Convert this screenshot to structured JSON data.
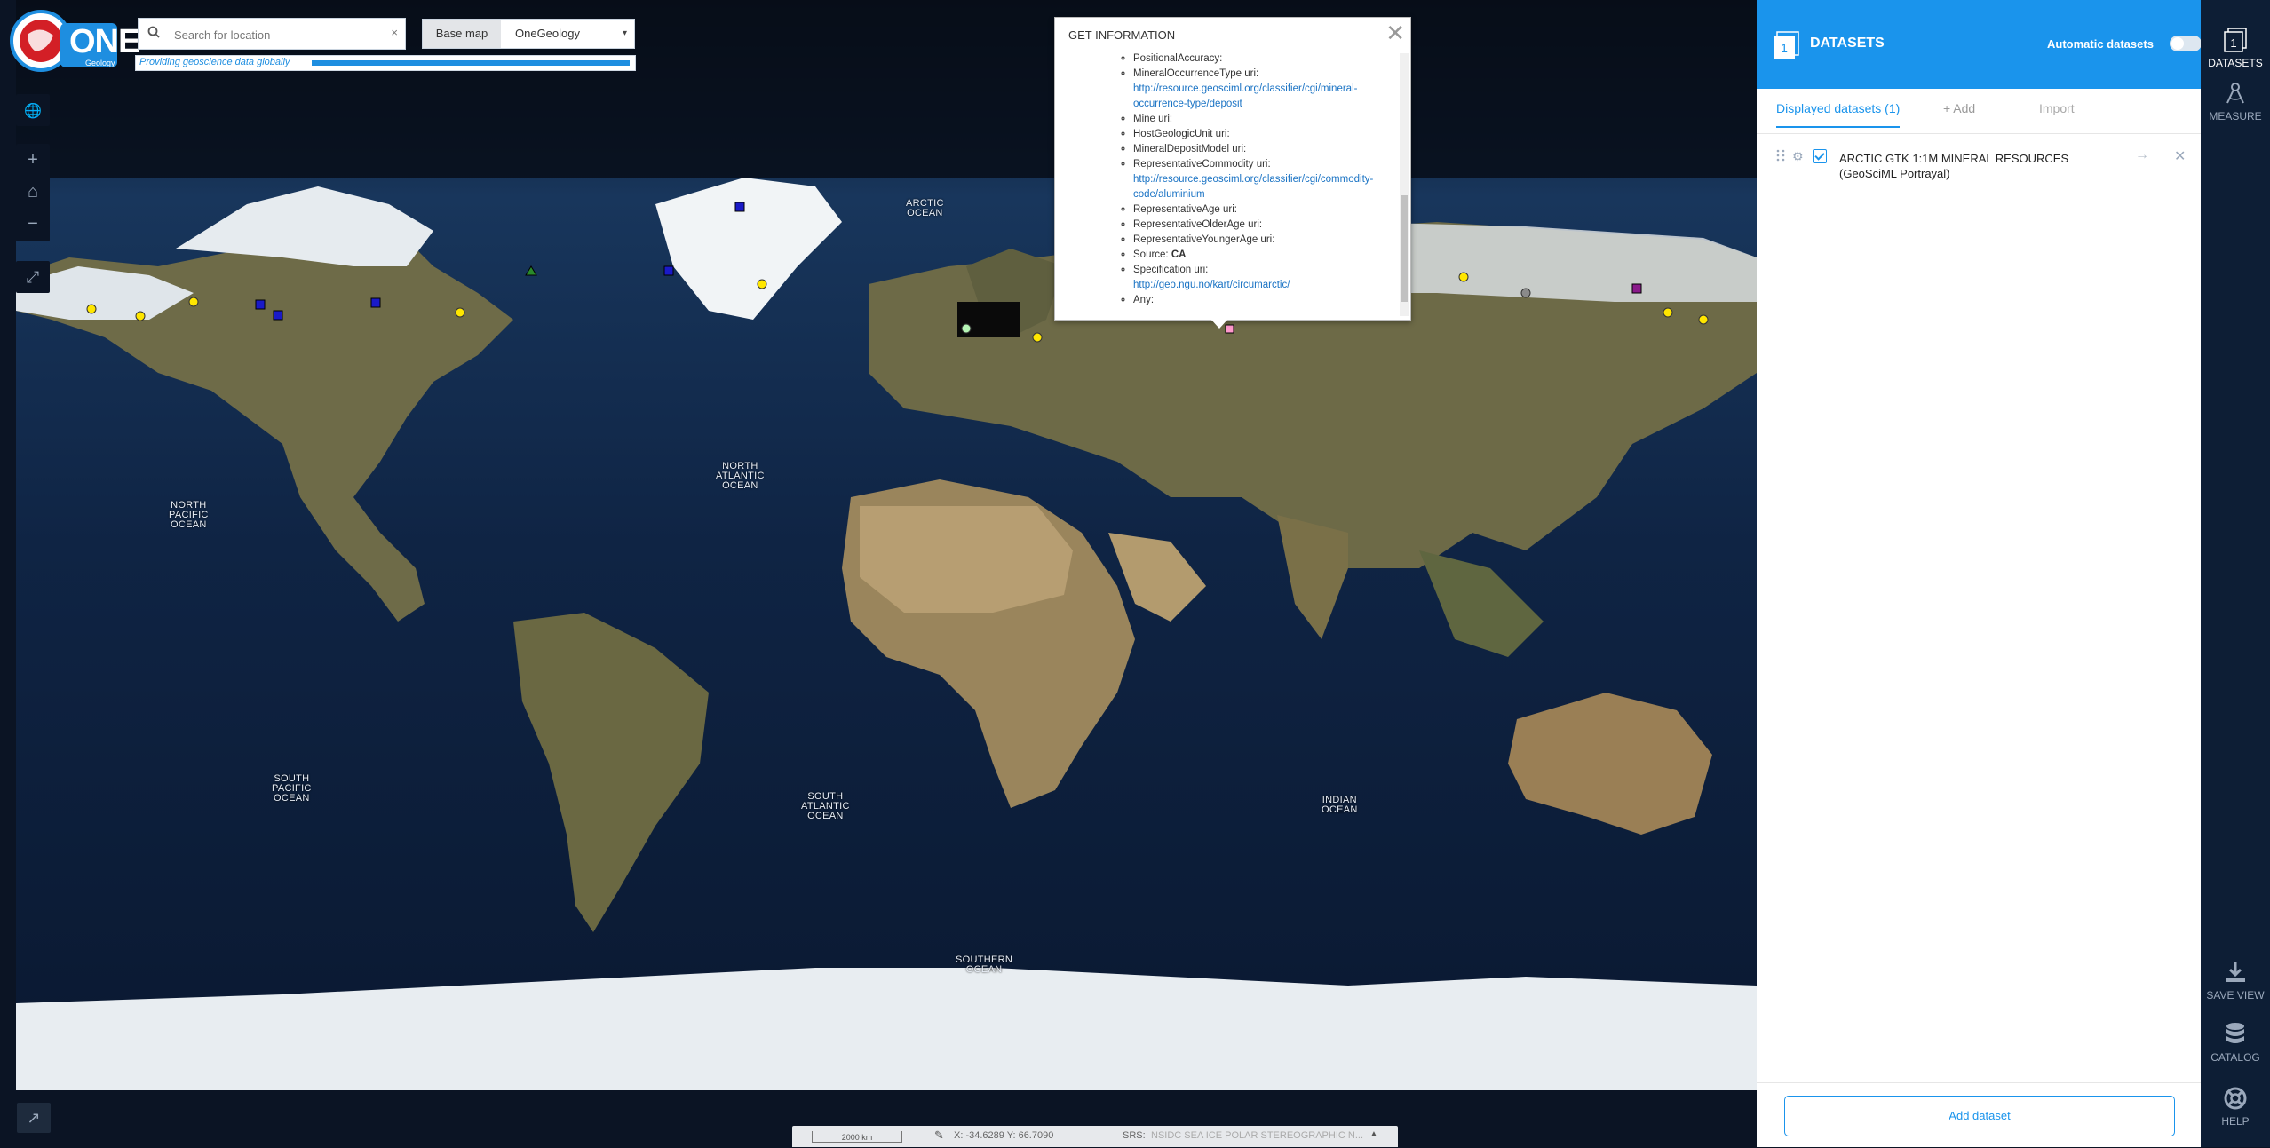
{
  "header": {
    "logo_text": "ONE",
    "logo_subtext": "Geology",
    "tagline": "Providing geoscience data globally",
    "search": {
      "placeholder": "Search for location",
      "clear": "×"
    },
    "basemap": {
      "label": "Base map",
      "value": "OneGeology",
      "caret": "▾"
    }
  },
  "map_tools": {
    "globe": "🌐",
    "zoom_in": "+",
    "home": "⌂",
    "zoom_out": "−",
    "fullscreen": "⤢",
    "expand": "↗"
  },
  "ocean_labels": [
    {
      "id": "arctic",
      "text": "ARCTIC\nOCEAN"
    },
    {
      "id": "north-atlantic",
      "text": "NORTH\nATLANTIC\nOCEAN"
    },
    {
      "id": "north-pacific",
      "text": "NORTH\nPACIFIC\nOCEAN"
    },
    {
      "id": "south-pacific",
      "text": "SOUTH\nPACIFIC\nOCEAN"
    },
    {
      "id": "south-atlantic",
      "text": "SOUTH\nATLANTIC\nOCEAN"
    },
    {
      "id": "indian",
      "text": "INDIAN\nOCEAN"
    },
    {
      "id": "southern",
      "text": "SOUTHERN\nOCEAN"
    }
  ],
  "popup": {
    "title": "GET INFORMATION",
    "close": "✕",
    "items": [
      {
        "label": "PositionalAccuracy:",
        "value": "",
        "link": ""
      },
      {
        "label": "MineralOccurrenceType uri:",
        "value": "",
        "link": "http://resource.geosciml.org/classifier/cgi/mineral-occurrence-type/deposit"
      },
      {
        "label": "Mine uri:",
        "value": "",
        "link": ""
      },
      {
        "label": "HostGeologicUnit uri:",
        "value": "",
        "link": ""
      },
      {
        "label": "MineralDepositModel uri:",
        "value": "",
        "link": ""
      },
      {
        "label": "RepresentativeCommodity uri:",
        "value": "",
        "link": "http://resource.geosciml.org/classifier/cgi/commodity-code/aluminium"
      },
      {
        "label": "RepresentativeAge uri:",
        "value": "",
        "link": ""
      },
      {
        "label": "RepresentativeOlderAge uri:",
        "value": "",
        "link": ""
      },
      {
        "label": "RepresentativeYoungerAge uri:",
        "value": "",
        "link": ""
      },
      {
        "label": "Source:",
        "value": "CA",
        "link": ""
      },
      {
        "label": "Specification uri:",
        "value": "",
        "link": "http://geo.ngu.no/kart/circumarctic/"
      },
      {
        "label": "Any:",
        "value": "",
        "link": ""
      }
    ]
  },
  "panel": {
    "badge": "1",
    "title": "DATASETS",
    "auto_label": "Automatic datasets",
    "tabs": {
      "displayed": "Displayed datasets (1)",
      "add": "+ Add",
      "import": "Import"
    },
    "dataset": {
      "name": "ARCTIC GTK 1:1M MINERAL RESOURCES (GeoSciML Portrayal)",
      "go": "→",
      "remove": "✕"
    },
    "add_button": "Add dataset"
  },
  "rail": {
    "datasets_badge": "1",
    "datasets": "DATASETS",
    "measure": "MEASURE",
    "save_view": "SAVE VIEW",
    "catalog": "CATALOG",
    "help": "HELP"
  },
  "status": {
    "scale": "2000 km",
    "pencil": "✎",
    "coords": "X: -34.6289 Y: 66.7090",
    "srs_label": "SRS:",
    "srs_value": "NSIDC SEA ICE POLAR STEREOGRAPHIC N...",
    "caret": "▲"
  },
  "colors": {
    "accent": "#1a94ec",
    "rail_bg": "#0d1e35",
    "ocean": "#0d1a30",
    "land": "#6b6a44"
  }
}
